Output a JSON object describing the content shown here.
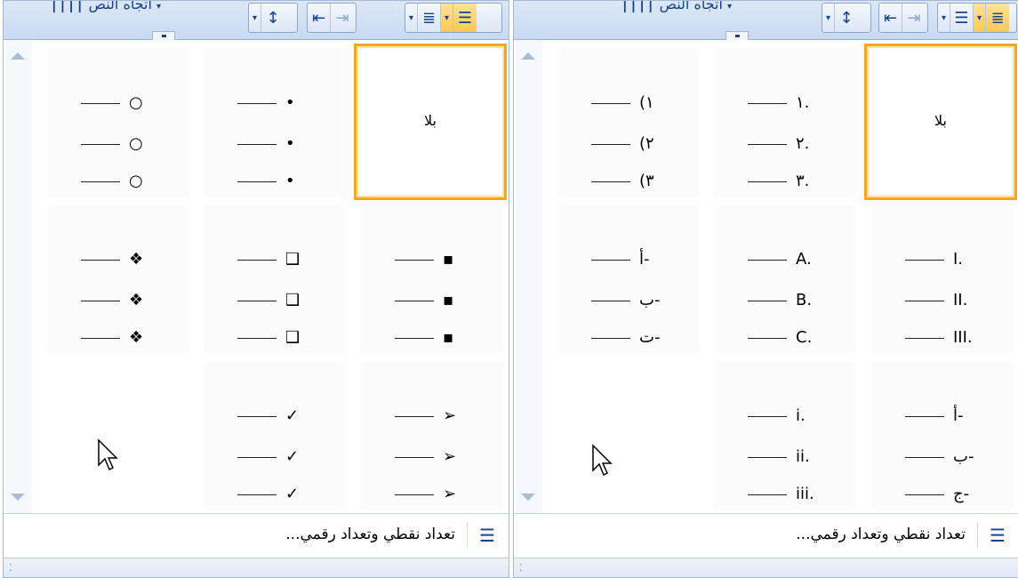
{
  "colors": {
    "ribbon": "#c8daf1",
    "selected_border": "#f5a623",
    "text_blue": "#15428b"
  },
  "ribbon": {
    "label": "اتجاه النص",
    "dropdown_glyph": "▾",
    "text_dir_glyph": "||||"
  },
  "left": {
    "cells": [
      {
        "id": "none",
        "label": "بلا"
      },
      {
        "id": "dot",
        "marks": [
          "•",
          "•",
          "•"
        ]
      },
      {
        "id": "circle",
        "marks": [
          "○",
          "○",
          "○"
        ]
      },
      {
        "id": "small-square",
        "marks": [
          "▪",
          "▪",
          "▪"
        ]
      },
      {
        "id": "hollow-square",
        "marks": [
          "❑",
          "❑",
          "❑"
        ]
      },
      {
        "id": "diamond-dots",
        "marks": [
          "❖",
          "❖",
          "❖"
        ]
      },
      {
        "id": "arrowhead",
        "marks": [
          "➢",
          "➢",
          "➢"
        ]
      },
      {
        "id": "checkmark",
        "marks": [
          "✓",
          "✓",
          "✓"
        ]
      }
    ],
    "footer_label": "تعداد نقطي وتعداد رقمي..."
  },
  "right": {
    "cells": [
      {
        "id": "none",
        "label": "بلا"
      },
      {
        "id": "arabic-dot",
        "marks": [
          "١.",
          "٢.",
          "٣."
        ]
      },
      {
        "id": "arabic-paren",
        "marks": [
          "(١",
          "(٢",
          "(٣"
        ]
      },
      {
        "id": "roman-upper",
        "marks": [
          "I.",
          "II.",
          "III."
        ]
      },
      {
        "id": "latin-upper",
        "marks": [
          "A.",
          "B.",
          "C."
        ]
      },
      {
        "id": "arabic-letter-hyphen",
        "marks": [
          "أ-",
          "ب-",
          "ت-"
        ]
      },
      {
        "id": "arabic-letter-abjad",
        "marks": [
          "أ-",
          "ب-",
          "ج-"
        ]
      },
      {
        "id": "roman-lower",
        "marks": [
          "i.",
          "ii.",
          "iii."
        ]
      }
    ],
    "footer_label": "تعداد نقطي وتعداد رقمي..."
  },
  "icons": {
    "list": "☰",
    "grip": "⁚"
  }
}
